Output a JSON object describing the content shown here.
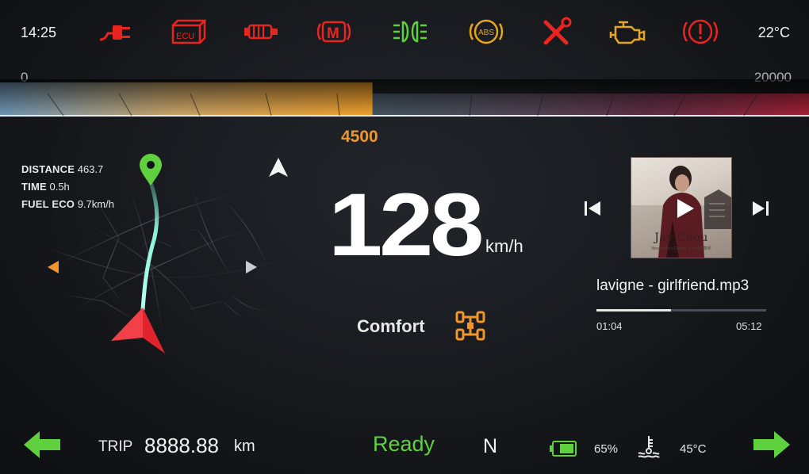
{
  "status_bar": {
    "time": "14:25",
    "temperature": "22°C",
    "warning_icons": [
      {
        "name": "charging-plug-icon",
        "color": "#e8251f"
      },
      {
        "name": "ecu-fault-icon",
        "label": "ECU",
        "color": "#e8251f"
      },
      {
        "name": "battery-fault-icon",
        "color": "#e8251f"
      },
      {
        "name": "motor-fault-icon",
        "label": "M",
        "color": "#e8251f"
      },
      {
        "name": "headlight-icon",
        "color": "#5fd13f"
      },
      {
        "name": "abs-warning-icon",
        "label": "ABS",
        "color": "#e7a51c"
      },
      {
        "name": "service-wrench-icon",
        "color": "#e8251f"
      },
      {
        "name": "check-engine-icon",
        "color": "#e7a51c"
      },
      {
        "name": "brake-warning-icon",
        "color": "#e8251f"
      }
    ]
  },
  "rpm": {
    "min_label": "0",
    "max_label": "20000",
    "min": 0,
    "max": 20000,
    "value": 4500,
    "value_label": "4500",
    "accent_color": "#f0962a"
  },
  "trip_info": {
    "distance_label": "DISTANCE",
    "distance_value": "463.7",
    "time_label": "TIME",
    "time_value": "0.5h",
    "fuel_label": "FUEL ECO",
    "fuel_value": "9.7km/h"
  },
  "speed": {
    "value": "128",
    "unit": "km/h"
  },
  "drive_mode": {
    "label": "Comfort",
    "icon": "drivetrain-icon",
    "color": "#f0962a"
  },
  "media": {
    "album_artist": "Jay Chou",
    "album_subtitle": "November's Chopin 十一月的萧邦",
    "track_title": "lavigne - girlfriend.mp3",
    "elapsed": "01:04",
    "total": "05:12",
    "progress_fraction": 0.44
  },
  "bottom_bar": {
    "trip_label": "TRIP",
    "trip_value": "8888.88",
    "trip_unit": "km",
    "status": "Ready",
    "status_color": "#5fd13f",
    "gear": "N",
    "battery_percent": "65%",
    "coolant_temp": "45°C",
    "turn_signal_color": "#5fd13f"
  }
}
